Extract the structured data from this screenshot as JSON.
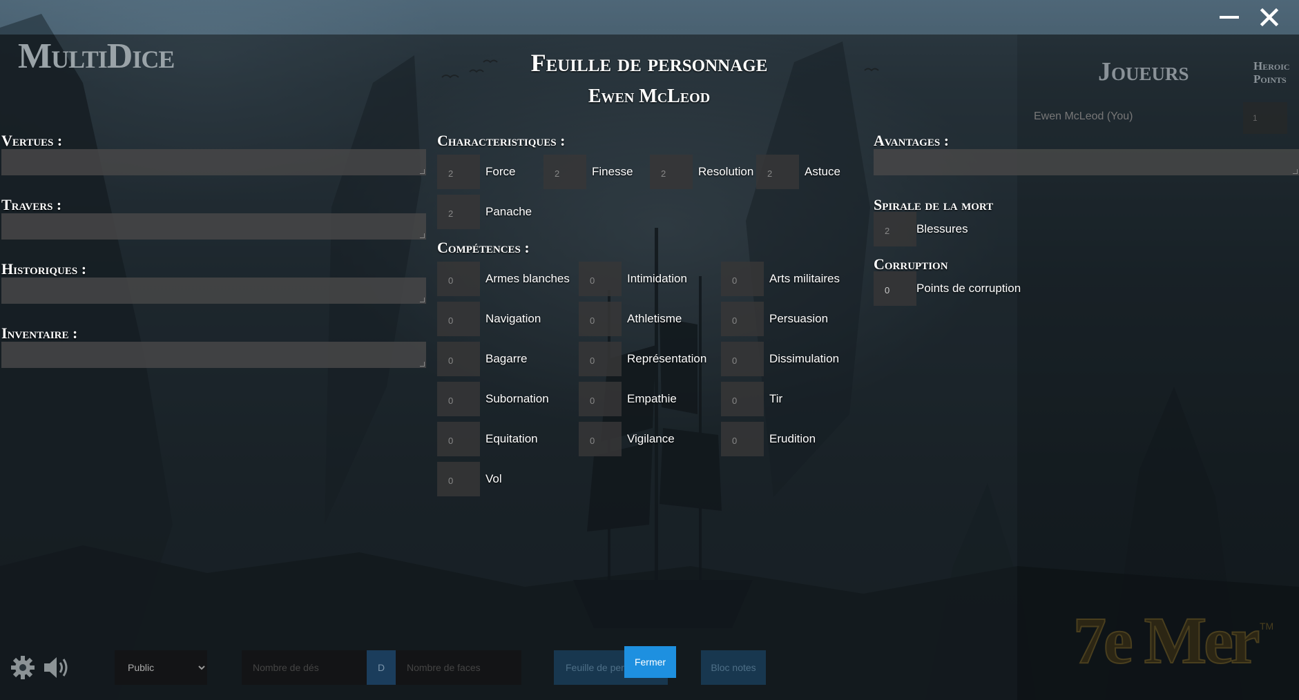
{
  "window": {
    "minimize_icon": "minimize-icon",
    "close_icon": "close-icon"
  },
  "app": {
    "logo": "MultiDice"
  },
  "sheet": {
    "title": "Feuille de personnage",
    "character_name": "Ewen McLeod"
  },
  "left_sections": [
    {
      "label": "Vertues :",
      "value": ""
    },
    {
      "label": "Travers :",
      "value": ""
    },
    {
      "label": "Historiques :",
      "value": ""
    },
    {
      "label": "Inventaire :",
      "value": ""
    }
  ],
  "characteristics": {
    "label": "Characteristiques :",
    "items": [
      {
        "name": "Force",
        "value": "2"
      },
      {
        "name": "Finesse",
        "value": "2"
      },
      {
        "name": "Resolution",
        "value": "2"
      },
      {
        "name": "Astuce",
        "value": "2"
      },
      {
        "name": "Panache",
        "value": "2"
      }
    ]
  },
  "skills": {
    "label": "Compétences :",
    "items": [
      {
        "name": "Armes blanches",
        "value": "0"
      },
      {
        "name": "Intimidation",
        "value": "0"
      },
      {
        "name": "Arts militaires",
        "value": "0"
      },
      {
        "name": "Navigation",
        "value": "0"
      },
      {
        "name": "Athletisme",
        "value": "0"
      },
      {
        "name": "Persuasion",
        "value": "0"
      },
      {
        "name": "Bagarre",
        "value": "0"
      },
      {
        "name": "Représentation",
        "value": "0"
      },
      {
        "name": "Dissimulation",
        "value": "0"
      },
      {
        "name": "Subornation",
        "value": "0"
      },
      {
        "name": "Empathie",
        "value": "0"
      },
      {
        "name": "Tir",
        "value": "0"
      },
      {
        "name": "Equitation",
        "value": "0"
      },
      {
        "name": "Vigilance",
        "value": "0"
      },
      {
        "name": "Erudition",
        "value": "0"
      },
      {
        "name": "Vol",
        "value": "0"
      }
    ]
  },
  "advantages": {
    "label": "Avantages :",
    "value": ""
  },
  "death_spiral": {
    "label": "Spirale de la mort",
    "stat": {
      "name": "Blessures",
      "value": "2"
    }
  },
  "corruption": {
    "label": "Corruption",
    "stat": {
      "name": "Points de corruption",
      "value": "0"
    }
  },
  "sidebar": {
    "players_title": "Joueurs",
    "heroic_title_1": "Heroic",
    "heroic_title_2": "Points",
    "players": [
      {
        "name": "Ewen McLeod (You)",
        "heroic_points": "1"
      }
    ]
  },
  "bottom_bar": {
    "settings_icon": "gear-icon",
    "sound_icon": "speaker-icon",
    "visibility_select": "Public",
    "dice_count_placeholder": "Nombre de dés",
    "dice_separator": "D",
    "dice_faces_placeholder": "Nombre de faces",
    "sheet_button": "Feuille de personnage",
    "close_button": "Fermer",
    "notes_button": "Bloc notes"
  },
  "brand": {
    "text": "7e Mer",
    "trademark": "TM"
  }
}
